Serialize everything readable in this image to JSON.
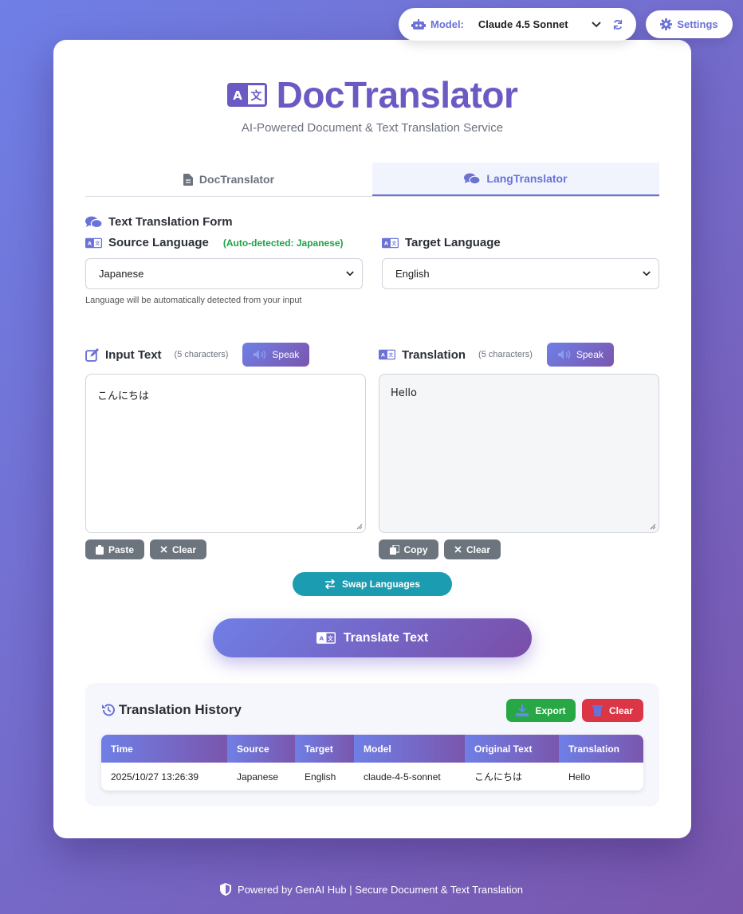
{
  "model": {
    "label": "Model:",
    "value": "Claude 4.5 Sonnet"
  },
  "settings": {
    "label": "Settings"
  },
  "brand": {
    "title": "DocTranslator",
    "subtitle": "AI-Powered Document & Text Translation Service"
  },
  "tabs": [
    {
      "label": "DocTranslator"
    },
    {
      "label": "LangTranslator",
      "active": true
    }
  ],
  "form": {
    "title": "Text Translation Form",
    "source": {
      "label": "Source Language",
      "auto": "(Auto-detected: Japanese)",
      "value": "Japanese"
    },
    "target": {
      "label": "Target Language",
      "value": "English"
    },
    "hint": "Language will be automatically detected from your input"
  },
  "input": {
    "label": "Input Text",
    "count": "(5 characters)",
    "speak": "Speak",
    "text": "こんにちは",
    "paste": "Paste",
    "clear": "Clear"
  },
  "output": {
    "label": "Translation",
    "count": "(5 characters)",
    "speak": "Speak",
    "text": "Hello",
    "copy": "Copy",
    "clear": "Clear"
  },
  "swap": {
    "label": "Swap Languages"
  },
  "translate": {
    "label": "Translate Text"
  },
  "history": {
    "title": "Translation History",
    "export": "Export",
    "clear": "Clear",
    "columns": [
      "Time",
      "Source",
      "Target",
      "Model",
      "Original Text",
      "Translation"
    ],
    "rows": [
      [
        "2025/10/27 13:26:39",
        "Japanese",
        "English",
        "claude-4-5-sonnet",
        "こんにちは",
        "Hello"
      ]
    ]
  },
  "footer": {
    "text": "Powered by GenAI Hub | Secure Document & Text Translation"
  },
  "colors": {
    "accent": "#6a72d6",
    "teal": "#1b9cb0",
    "success": "#28a745",
    "danger": "#dc3545",
    "secondary": "#6c757d"
  }
}
